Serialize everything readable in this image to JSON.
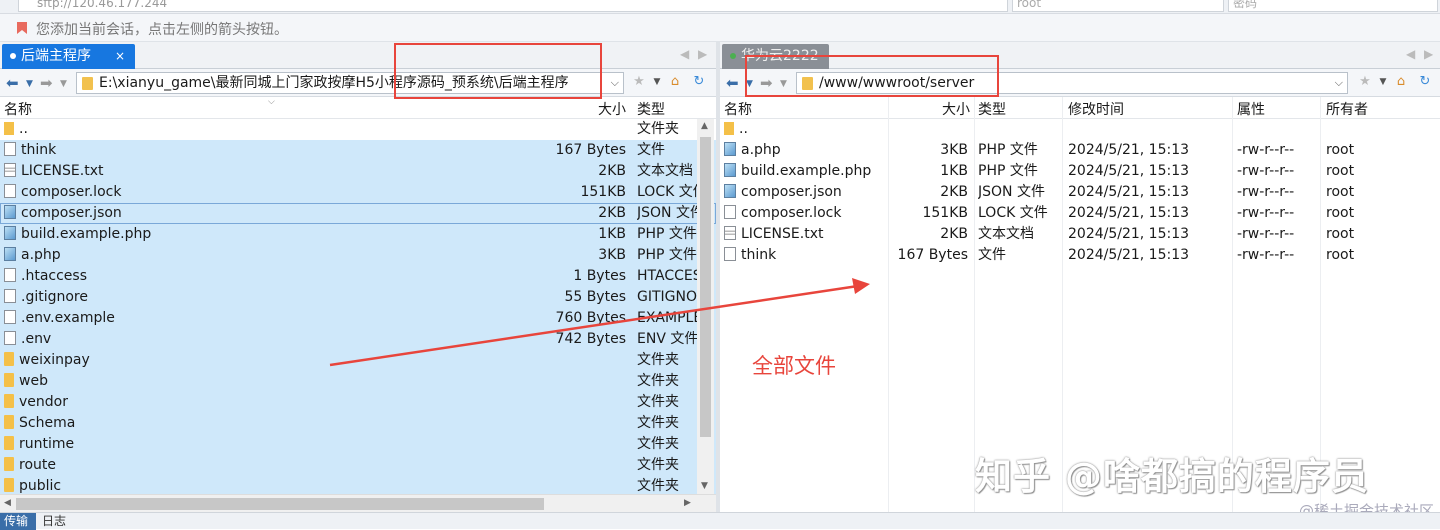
{
  "session": {
    "address": "sftp://120.46.177.244",
    "username": "root",
    "password_label": "密码",
    "hint": "您添加当前会话，点击左侧的箭头按钮。"
  },
  "left": {
    "tab_label": "后端主程序",
    "path": "E:\\xianyu_game\\最新同城上门家政按摩H5小程序源码_预系统\\后端主程序",
    "columns": {
      "name": "名称",
      "size": "大小",
      "type": "类型"
    },
    "files": [
      {
        "name": "..",
        "size": "",
        "type": "文件夹",
        "icon": "folder-up-icon",
        "selected": false
      },
      {
        "name": "think",
        "size": "167 Bytes",
        "type": "文件",
        "icon": "file-icon",
        "selected": true
      },
      {
        "name": "LICENSE.txt",
        "size": "2KB",
        "type": "文本文档",
        "icon": "text-file-icon",
        "selected": true
      },
      {
        "name": "composer.lock",
        "size": "151KB",
        "type": "LOCK 文件",
        "icon": "file-icon",
        "selected": true
      },
      {
        "name": "composer.json",
        "size": "2KB",
        "type": "JSON 文件",
        "icon": "php-file-icon",
        "selected": true
      },
      {
        "name": "build.example.php",
        "size": "1KB",
        "type": "PHP 文件",
        "icon": "php-file-icon",
        "selected": true
      },
      {
        "name": "a.php",
        "size": "3KB",
        "type": "PHP 文件",
        "icon": "php-file-icon",
        "selected": true
      },
      {
        "name": ".htaccess",
        "size": "1 Bytes",
        "type": "HTACCESS",
        "icon": "file-icon",
        "selected": true
      },
      {
        "name": ".gitignore",
        "size": "55 Bytes",
        "type": "GITIGNORE",
        "icon": "file-icon",
        "selected": true
      },
      {
        "name": ".env.example",
        "size": "760 Bytes",
        "type": "EXAMPLE",
        "icon": "file-icon",
        "selected": true
      },
      {
        "name": ".env",
        "size": "742 Bytes",
        "type": "ENV 文件",
        "icon": "file-icon",
        "selected": true
      },
      {
        "name": "weixinpay",
        "size": "",
        "type": "文件夹",
        "icon": "folder-icon",
        "selected": true
      },
      {
        "name": "web",
        "size": "",
        "type": "文件夹",
        "icon": "folder-icon",
        "selected": true
      },
      {
        "name": "vendor",
        "size": "",
        "type": "文件夹",
        "icon": "folder-icon",
        "selected": true
      },
      {
        "name": "Schema",
        "size": "",
        "type": "文件夹",
        "icon": "folder-icon",
        "selected": true
      },
      {
        "name": "runtime",
        "size": "",
        "type": "文件夹",
        "icon": "folder-icon",
        "selected": true
      },
      {
        "name": "route",
        "size": "",
        "type": "文件夹",
        "icon": "folder-icon",
        "selected": true
      },
      {
        "name": "public",
        "size": "",
        "type": "文件夹",
        "icon": "folder-icon",
        "selected": true
      }
    ]
  },
  "right": {
    "tab_label": "华为云2222",
    "path": "/www/wwwroot/server",
    "columns": {
      "name": "名称",
      "size": "大小",
      "type": "类型",
      "modified": "修改时间",
      "attributes": "属性",
      "owner": "所有者"
    },
    "files": [
      {
        "name": "..",
        "size": "",
        "type": "",
        "modified": "",
        "attributes": "",
        "owner": "",
        "icon": "folder-up-icon"
      },
      {
        "name": "a.php",
        "size": "3KB",
        "type": "PHP 文件",
        "modified": "2024/5/21, 15:13",
        "attributes": "-rw-r--r--",
        "owner": "root",
        "icon": "php-file-icon"
      },
      {
        "name": "build.example.php",
        "size": "1KB",
        "type": "PHP 文件",
        "modified": "2024/5/21, 15:13",
        "attributes": "-rw-r--r--",
        "owner": "root",
        "icon": "php-file-icon"
      },
      {
        "name": "composer.json",
        "size": "2KB",
        "type": "JSON 文件",
        "modified": "2024/5/21, 15:13",
        "attributes": "-rw-r--r--",
        "owner": "root",
        "icon": "php-file-icon"
      },
      {
        "name": "composer.lock",
        "size": "151KB",
        "type": "LOCK 文件",
        "modified": "2024/5/21, 15:13",
        "attributes": "-rw-r--r--",
        "owner": "root",
        "icon": "file-icon"
      },
      {
        "name": "LICENSE.txt",
        "size": "2KB",
        "type": "文本文档",
        "modified": "2024/5/21, 15:13",
        "attributes": "-rw-r--r--",
        "owner": "root",
        "icon": "text-file-icon"
      },
      {
        "name": "think",
        "size": "167 Bytes",
        "type": "文件",
        "modified": "2024/5/21, 15:13",
        "attributes": "-rw-r--r--",
        "owner": "root",
        "icon": "file-icon"
      }
    ]
  },
  "annotation": "全部文件",
  "watermark": "知乎 @啥都搞的程序员",
  "credit": "@稀土掘金技术社区",
  "bottom": {
    "transfer_tab": "传输",
    "log_tab": "日志"
  },
  "colors": {
    "accent": "#1777e0",
    "selection": "#cfe8fa",
    "annotation_red": "#e8453c"
  }
}
